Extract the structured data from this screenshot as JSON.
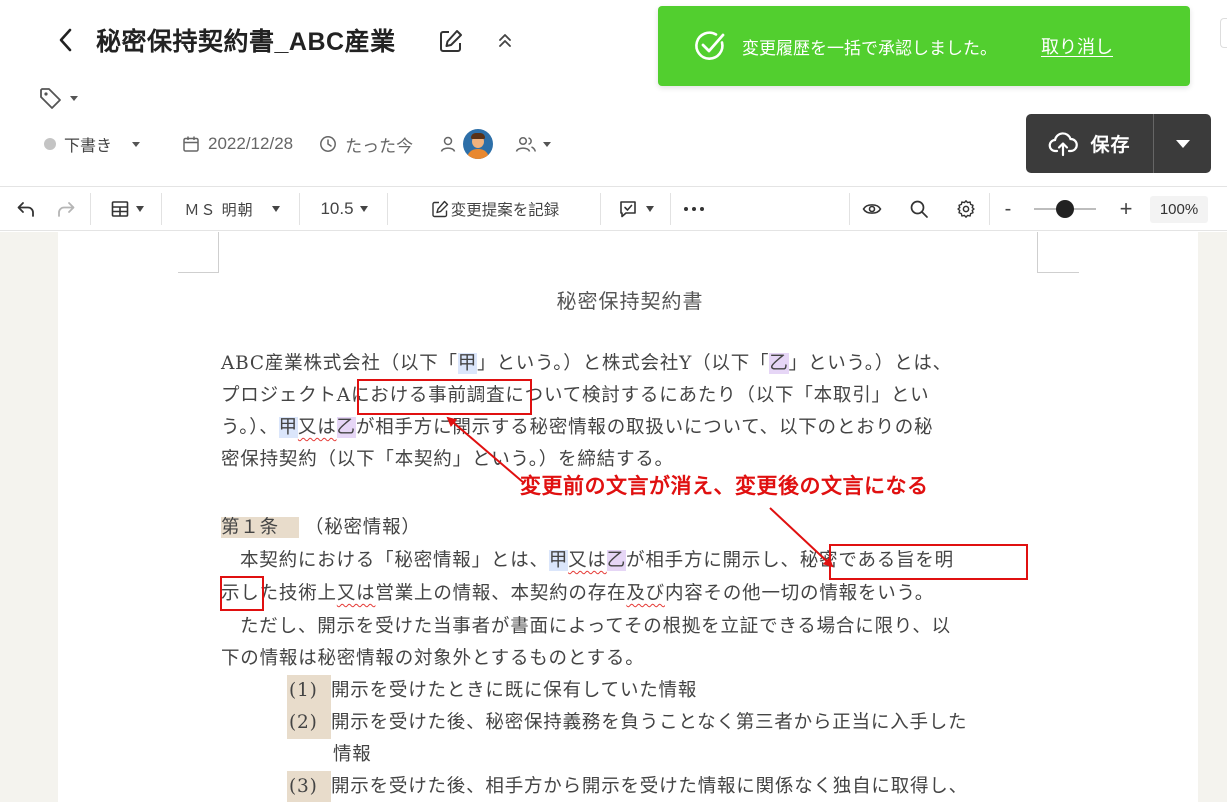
{
  "header": {
    "title": "秘密保持契約書_ABC産業",
    "status": "下書き",
    "date": "2022/12/28",
    "updated": "たった今",
    "save_label": "保存"
  },
  "toast": {
    "message": "変更履歴を一括で承認しました。",
    "undo": "取り消し",
    "color": "#52cf2f"
  },
  "toolbar": {
    "font": "ＭＳ 明朝",
    "font_size": "10.5",
    "track_changes": "変更提案を記録",
    "zoom_minus": "-",
    "zoom_plus": "+",
    "zoom": "100%",
    "zoom_level": 0.5
  },
  "document": {
    "heading": "秘密保持契約書",
    "para1": {
      "l1": [
        "ABC産業株式会社（以下「",
        "甲",
        "」という。）と株式会社Y（以下「",
        "乙",
        "」という。）とは、"
      ],
      "l2": [
        "プロジェクトA",
        "における事前調査",
        "について検討するにあたり（以下「本取引」とい"
      ],
      "l3": [
        "う。）、",
        "甲",
        "又は",
        "乙",
        "が相手方に開示する秘密情報の取扱いについて、以下のとおりの秘"
      ],
      "l4": "密保持契約（以下「本契約」という。）を締結する。"
    },
    "article1": {
      "title": "第１条",
      "subtitle": "（秘密情報）",
      "l1": [
        "本契約における「秘密情報」とは、",
        "甲",
        "又は",
        "乙",
        "が相手方に開示し、",
        "秘密である旨を明"
      ],
      "l2": [
        "示し",
        "た技術上",
        "又は",
        "営業上の情報、本契約の存在",
        "及び",
        "内容その他一切の情報をいう。"
      ],
      "l3": "ただし、開示を受けた当事者が書面によってその根拠を立証できる場合に限り、以",
      "l4": "下の情報は秘密情報の対象外とするものとする。",
      "items": [
        {
          "num": "(1)",
          "text": "開示を受けたときに既に保有していた情報"
        },
        {
          "num": "(2)",
          "text": "開示を受けた後、秘密保持義務を負うことなく第三者から正当に入手した"
        },
        {
          "num": "",
          "text": "情報"
        },
        {
          "num": "(3)",
          "text": "開示を受けた後、相手方から開示を受けた情報に関係なく独自に取得し、"
        }
      ]
    }
  },
  "annotation": {
    "text": "変更前の文言が消え、変更後の文言になる",
    "color": "#e01010"
  }
}
